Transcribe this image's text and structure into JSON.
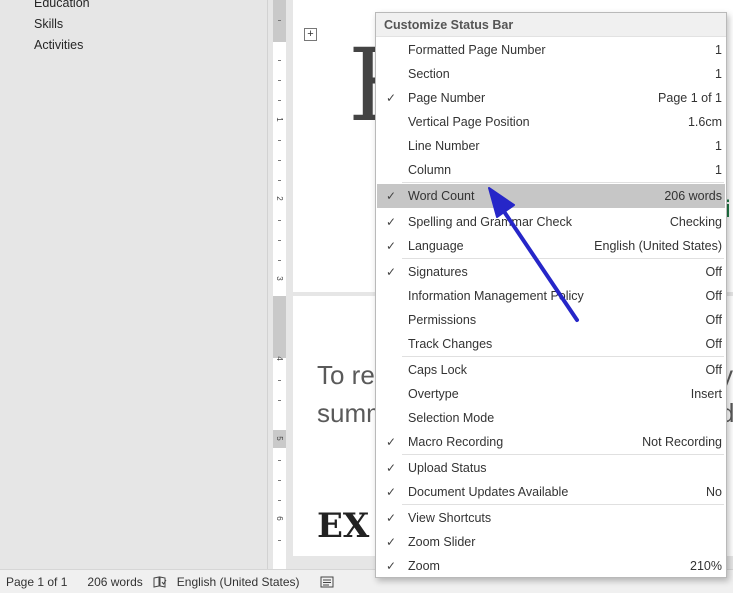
{
  "nav": {
    "items": [
      "Education",
      "Skills",
      "Activities"
    ]
  },
  "ruler": {
    "numbers": [
      "1",
      "2",
      "3",
      "4",
      "5",
      "6"
    ]
  },
  "document": {
    "big_initial": "H",
    "green_fragment": "i",
    "body_line_1": "To re",
    "body_line_1_tail": "y",
    "body_line_2": "summ",
    "body_line_2_tail": "d",
    "heading_fragment": "EX"
  },
  "status_bar": {
    "page": "Page 1 of 1",
    "words": "206 words",
    "language": "English (United States)",
    "proofing_icon": "proofing-book-icon",
    "view_icon": "read-mode-icon"
  },
  "menu": {
    "title": "Customize Status Bar",
    "items": [
      {
        "label": "Formatted Page Number",
        "value": "1",
        "checked": false
      },
      {
        "label": "Section",
        "value": "1",
        "checked": false
      },
      {
        "label": "Page Number",
        "value": "Page 1 of 1",
        "checked": true
      },
      {
        "label": "Vertical Page Position",
        "value": "1.6cm",
        "checked": false
      },
      {
        "label": "Line Number",
        "value": "1",
        "checked": false
      },
      {
        "label": "Column",
        "value": "1",
        "checked": false
      },
      {
        "label": "Word Count",
        "value": "206 words",
        "checked": true
      },
      {
        "label": "Spelling and Grammar Check",
        "value": "Checking",
        "checked": true
      },
      {
        "label": "Language",
        "value": "English (United States)",
        "checked": true
      },
      {
        "label": "Signatures",
        "value": "Off",
        "checked": true
      },
      {
        "label": "Information Management Policy",
        "value": "Off",
        "checked": false
      },
      {
        "label": "Permissions",
        "value": "Off",
        "checked": false
      },
      {
        "label": "Track Changes",
        "value": "Off",
        "checked": false
      },
      {
        "label": "Caps Lock",
        "value": "Off",
        "checked": false
      },
      {
        "label": "Overtype",
        "value": "Insert",
        "checked": false
      },
      {
        "label": "Selection Mode",
        "value": "",
        "checked": false
      },
      {
        "label": "Macro Recording",
        "value": "Not Recording",
        "checked": true
      },
      {
        "label": "Upload Status",
        "value": "",
        "checked": true
      },
      {
        "label": "Document Updates Available",
        "value": "No",
        "checked": true
      },
      {
        "label": "View Shortcuts",
        "value": "",
        "checked": true
      },
      {
        "label": "Zoom Slider",
        "value": "",
        "checked": true
      },
      {
        "label": "Zoom",
        "value": "210%",
        "checked": true
      }
    ],
    "check_glyph": "✓"
  },
  "colors": {
    "highlight": "#c6c6c6",
    "annotation_arrow": "#2626c8",
    "green_text": "#1e7a45"
  }
}
